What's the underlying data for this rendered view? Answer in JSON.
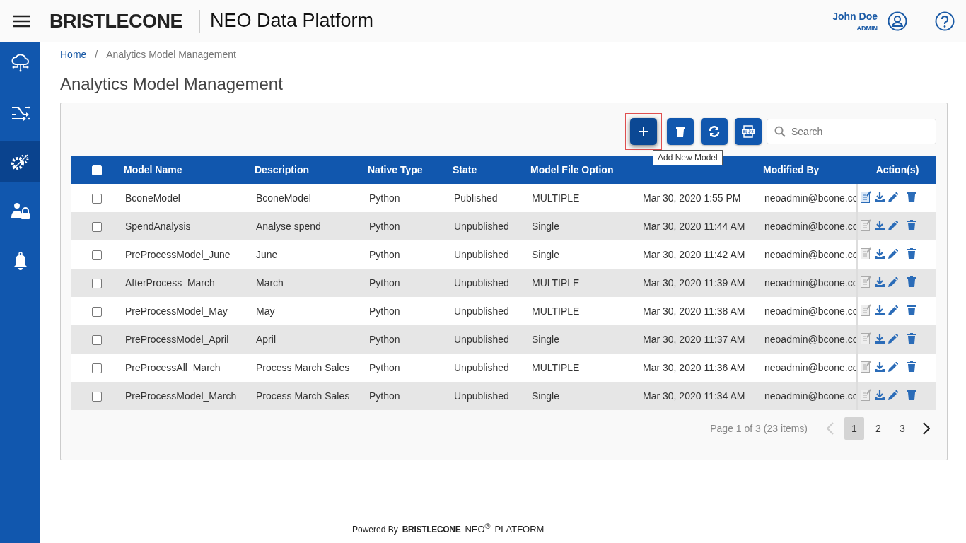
{
  "header": {
    "logo": "BRISTLECONE",
    "app_title": "NEO Data Platform",
    "user_name": "John Doe",
    "user_role": "ADMIN"
  },
  "sidebar": {
    "items": [
      {
        "kind": "cloud",
        "selected": false
      },
      {
        "kind": "shuffle",
        "selected": false
      },
      {
        "kind": "gears",
        "selected": true
      },
      {
        "kind": "user-lock",
        "selected": false
      },
      {
        "kind": "bell",
        "selected": false
      }
    ]
  },
  "breadcrumb": {
    "separator": "/",
    "items": [
      {
        "label": "Home",
        "link": true
      },
      {
        "label": "Analytics Model Management",
        "link": false
      }
    ]
  },
  "page_title": "Analytics Model Management",
  "toolbar": {
    "buttons": [
      {
        "kind": "add",
        "highlighted": true
      },
      {
        "kind": "delete",
        "highlighted": false
      },
      {
        "kind": "refresh",
        "highlighted": false
      },
      {
        "kind": "xlsx",
        "highlighted": false
      }
    ],
    "tooltip": "Add New Model",
    "search": {
      "placeholder": "Search"
    }
  },
  "table": {
    "select_all": {
      "checked": false
    },
    "columns": [
      {
        "label": "Model Name"
      },
      {
        "label": "Description"
      },
      {
        "label": "Native Type"
      },
      {
        "label": "State"
      },
      {
        "label": "Model File Option"
      },
      {},
      {
        "label": "Modified By"
      },
      {
        "label": "Action(s)"
      }
    ],
    "rows": [
      {
        "checked": false,
        "cells": [
          "BconeModel",
          "BconeModel",
          "Python",
          "Published",
          "MULTIPLE",
          "Mar 30, 2020 1:55 PM",
          "neoadmin@bcone.co"
        ],
        "report_enabled": true
      },
      {
        "checked": false,
        "cells": [
          "SpendAnalysis",
          "Analyse spend",
          "Python",
          "Unpublished",
          "Single",
          "Mar 30, 2020 11:44 AM",
          "neoadmin@bcone.co"
        ],
        "report_enabled": false
      },
      {
        "checked": false,
        "cells": [
          "PreProcessModel_June",
          "June",
          "Python",
          "Unpublished",
          "Single",
          "Mar 30, 2020 11:42 AM",
          "neoadmin@bcone.co"
        ],
        "report_enabled": false
      },
      {
        "checked": false,
        "cells": [
          "AfterProcess_March",
          "March",
          "Python",
          "Unpublished",
          "MULTIPLE",
          "Mar 30, 2020 11:39 AM",
          "neoadmin@bcone.co"
        ],
        "report_enabled": false
      },
      {
        "checked": false,
        "cells": [
          "PreProcessModel_May",
          "May",
          "Python",
          "Unpublished",
          "MULTIPLE",
          "Mar 30, 2020 11:38 AM",
          "neoadmin@bcone.co"
        ],
        "report_enabled": false
      },
      {
        "checked": false,
        "cells": [
          "PreProcessModel_April",
          "April",
          "Python",
          "Unpublished",
          "Single",
          "Mar 30, 2020 11:37 AM",
          "neoadmin@bcone.co"
        ],
        "report_enabled": false
      },
      {
        "checked": false,
        "cells": [
          "PreProcessAll_March",
          "Process March Sales",
          "Python",
          "Unpublished",
          "MULTIPLE",
          "Mar 30, 2020 11:36 AM",
          "neoadmin@bcone.co"
        ],
        "report_enabled": false
      },
      {
        "checked": false,
        "cells": [
          "PreProcessModel_March",
          "Process March Sales",
          "Python",
          "Unpublished",
          "Single",
          "Mar 30, 2020 11:34 AM",
          "neoadmin@bcone.co"
        ],
        "report_enabled": false
      }
    ]
  },
  "pagination": {
    "summary": "Page 1 of 3 (23 items)",
    "prev_disabled": true,
    "next_disabled": false,
    "pages": [
      {
        "label": "1",
        "selected": true
      },
      {
        "label": "2",
        "selected": false
      },
      {
        "label": "3",
        "selected": false
      }
    ]
  },
  "footer": {
    "powered_by": "Powered By",
    "logo": "BRISTLECONE",
    "product": "NEO$^{®}$",
    "platform": "PLATFORM"
  }
}
